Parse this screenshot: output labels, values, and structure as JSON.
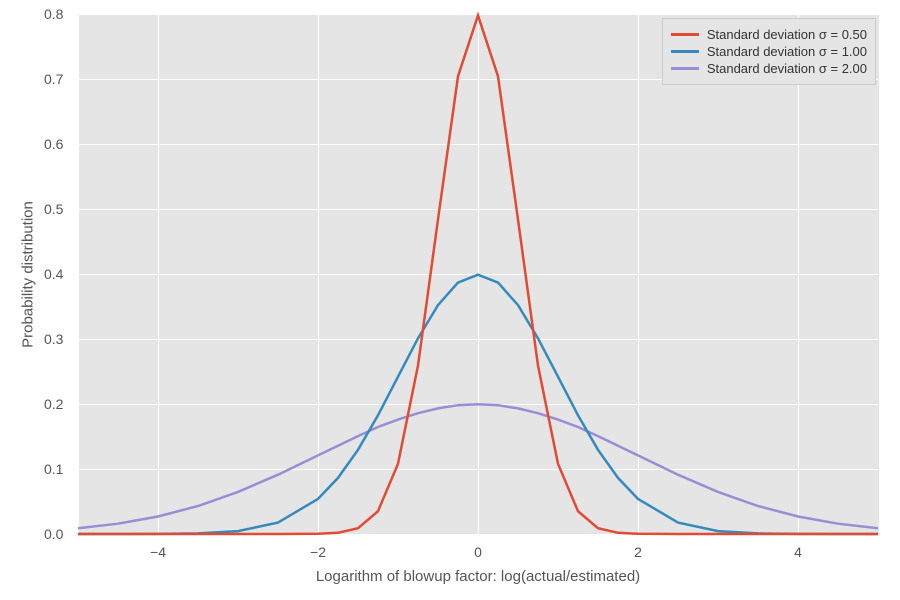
{
  "chart_data": {
    "type": "line",
    "xlabel": "Logarithm of blowup factor: log(actual/estimated)",
    "ylabel": "Probability distribution",
    "xlim": [
      -5,
      5
    ],
    "ylim": [
      0,
      0.8
    ],
    "xticks": [
      -4,
      -2,
      0,
      2,
      4
    ],
    "yticks": [
      0.0,
      0.1,
      0.2,
      0.3,
      0.4,
      0.5,
      0.6,
      0.7,
      0.8
    ],
    "legend_position": "upper right",
    "grid": true,
    "series": [
      {
        "name": "Standard deviation σ = 0.50",
        "color": "#e24a33",
        "sigma": 0.5,
        "x": [
          -5,
          -4.5,
          -4,
          -3.5,
          -3,
          -2.5,
          -2,
          -1.75,
          -1.5,
          -1.25,
          -1,
          -0.75,
          -0.5,
          -0.25,
          0,
          0.25,
          0.5,
          0.75,
          1,
          1.25,
          1.5,
          1.75,
          2,
          2.5,
          3,
          3.5,
          4,
          4.5,
          5
        ],
        "values": [
          0,
          0,
          0,
          0,
          0,
          0,
          0.0003,
          0.0018,
          0.0089,
          0.0351,
          0.108,
          0.259,
          0.4839,
          0.7041,
          0.7979,
          0.7041,
          0.4839,
          0.259,
          0.108,
          0.0351,
          0.0089,
          0.0018,
          0.0003,
          0,
          0,
          0,
          0,
          0,
          0
        ]
      },
      {
        "name": "Standard deviation σ = 1.00",
        "color": "#348abd",
        "sigma": 1.0,
        "x": [
          -5,
          -4.5,
          -4,
          -3.5,
          -3,
          -2.5,
          -2,
          -1.75,
          -1.5,
          -1.25,
          -1,
          -0.75,
          -0.5,
          -0.25,
          0,
          0.25,
          0.5,
          0.75,
          1,
          1.25,
          1.5,
          1.75,
          2,
          2.5,
          3,
          3.5,
          4,
          4.5,
          5
        ],
        "values": [
          0,
          0,
          0.0001,
          0.0009,
          0.0044,
          0.0175,
          0.054,
          0.0863,
          0.1295,
          0.1826,
          0.242,
          0.3011,
          0.3521,
          0.3867,
          0.3989,
          0.3867,
          0.3521,
          0.3011,
          0.242,
          0.1826,
          0.1295,
          0.0863,
          0.054,
          0.0175,
          0.0044,
          0.0009,
          0.0001,
          0,
          0
        ]
      },
      {
        "name": "Standard deviation σ = 2.00",
        "color": "#988ed5",
        "sigma": 2.0,
        "x": [
          -5,
          -4.5,
          -4,
          -3.5,
          -3,
          -2.5,
          -2,
          -1.75,
          -1.5,
          -1.25,
          -1,
          -0.75,
          -0.5,
          -0.25,
          0,
          0.25,
          0.5,
          0.75,
          1,
          1.25,
          1.5,
          1.75,
          2,
          2.5,
          3,
          3.5,
          4,
          4.5,
          5
        ],
        "values": [
          0.0088,
          0.0159,
          0.027,
          0.0431,
          0.0648,
          0.0913,
          0.121,
          0.1359,
          0.1506,
          0.1646,
          0.176,
          0.1858,
          0.1933,
          0.1982,
          0.1995,
          0.1982,
          0.1933,
          0.1858,
          0.176,
          0.1646,
          0.1506,
          0.1359,
          0.121,
          0.0913,
          0.0648,
          0.0431,
          0.027,
          0.0159,
          0.0088
        ]
      }
    ]
  },
  "xtick_labels": {
    "t0": "−4",
    "t1": "−2",
    "t2": "0",
    "t3": "2",
    "t4": "4"
  },
  "ytick_labels": {
    "t0": "0.0",
    "t1": "0.1",
    "t2": "0.2",
    "t3": "0.3",
    "t4": "0.4",
    "t5": "0.5",
    "t6": "0.6",
    "t7": "0.7",
    "t8": "0.8"
  },
  "legend": {
    "s0": "Standard deviation σ = 0.50",
    "s1": "Standard deviation σ = 1.00",
    "s2": "Standard deviation σ = 2.00"
  },
  "colors": {
    "s0": "#e24a33",
    "s1": "#348abd",
    "s2": "#988ed5"
  }
}
